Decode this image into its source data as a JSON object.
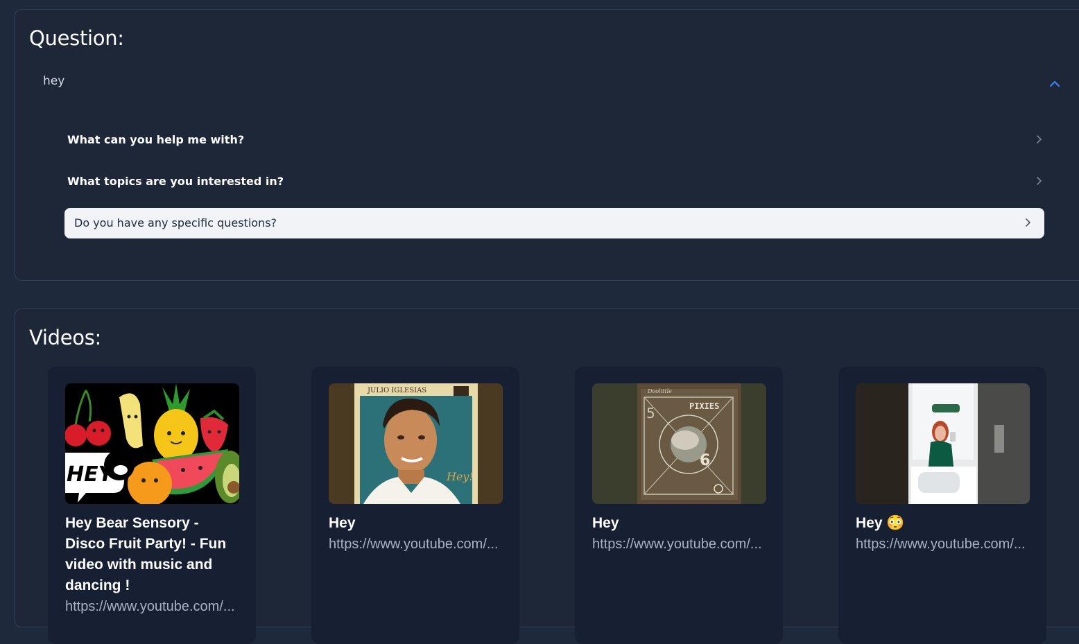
{
  "question": {
    "heading": "Question:",
    "query": "hey",
    "suggestions": [
      {
        "label": "What can you help me with?"
      },
      {
        "label": "What topics are you interested in?"
      },
      {
        "label": "Do you have any specific questions?"
      }
    ]
  },
  "videos": {
    "heading": "Videos:",
    "items": [
      {
        "title": "Hey Bear Sensory - Disco Fruit Party! - Fun video with music and dancing !",
        "url": "https://www.youtube.com/..."
      },
      {
        "title": "Hey",
        "url": "https://www.youtube.com/..."
      },
      {
        "title": "Hey",
        "url": "https://www.youtube.com/..."
      },
      {
        "title": "Hey 😳",
        "url": "https://www.youtube.com/..."
      }
    ]
  },
  "thumbnails": {
    "hey_bear_text": "HEY",
    "julio_artist": "JULIO IGLESIAS",
    "julio_signature": "Hey!",
    "pixies_band": "PIXIES",
    "pixies_album": "Doolittle"
  },
  "colors": {
    "background": "#1e293b",
    "accent": "#3b82f6",
    "active_suggestion_bg": "#f1f3f6"
  }
}
